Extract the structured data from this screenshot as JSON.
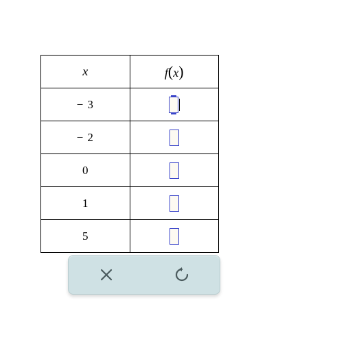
{
  "table": {
    "headers": {
      "x": "x",
      "fx_f": "f",
      "fx_x": "x"
    },
    "rows": [
      {
        "x": "− 3",
        "active": true
      },
      {
        "x": "− 2",
        "active": false
      },
      {
        "x": "0",
        "active": false
      },
      {
        "x": "1",
        "active": false
      },
      {
        "x": "5",
        "active": false
      }
    ]
  },
  "toolbar": {
    "close": "close-icon",
    "reset": "reset-icon"
  }
}
